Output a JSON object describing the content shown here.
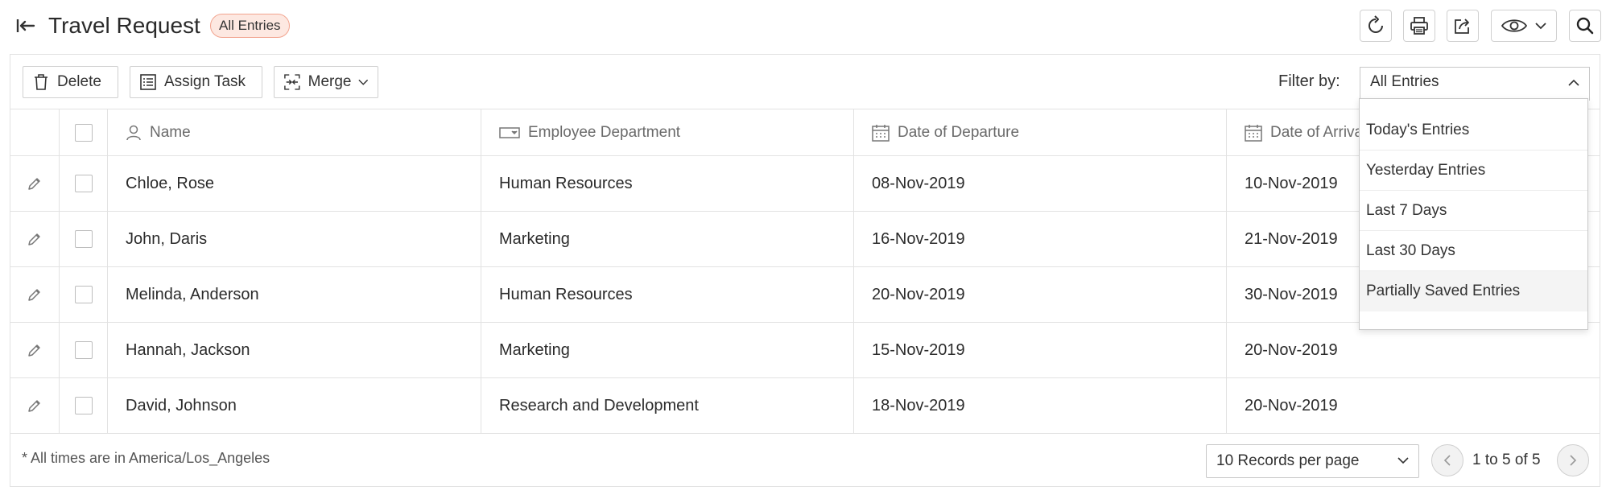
{
  "header": {
    "title": "Travel Request",
    "badge": "All Entries",
    "buttons": [
      "refresh-icon",
      "print-icon",
      "share-icon",
      "eye-icon",
      "search-icon"
    ]
  },
  "toolbar": {
    "delete_label": "Delete",
    "assign_label": "Assign Task",
    "merge_label": "Merge",
    "filter_label": "Filter by:",
    "filter_value": "All Entries"
  },
  "filter_options": [
    "Today's Entries",
    "Yesterday Entries",
    "Last 7 Days",
    "Last 30 Days",
    "Partially Saved Entries"
  ],
  "table": {
    "columns": {
      "name": "Name",
      "department": "Employee Department",
      "departure": "Date of Departure",
      "arrival": "Date of Arrival"
    },
    "rows": [
      {
        "name": "Chloe, Rose",
        "department": "Human Resources",
        "departure": "08-Nov-2019",
        "arrival": "10-Nov-2019"
      },
      {
        "name": "John, Daris",
        "department": "Marketing",
        "departure": "16-Nov-2019",
        "arrival": "21-Nov-2019"
      },
      {
        "name": "Melinda, Anderson",
        "department": "Human Resources",
        "departure": "20-Nov-2019",
        "arrival": "30-Nov-2019"
      },
      {
        "name": "Hannah, Jackson",
        "department": "Marketing",
        "departure": "15-Nov-2019",
        "arrival": "20-Nov-2019"
      },
      {
        "name": "David, Johnson",
        "department": "Research and Development",
        "departure": "18-Nov-2019",
        "arrival": "20-Nov-2019"
      }
    ]
  },
  "footer": {
    "timezone_note": "* All times are in America/Los_Angeles",
    "per_page": "10 Records per page",
    "page_info": "1 to 5 of 5"
  },
  "colors": {
    "badge_bg": "#fde8e1",
    "badge_border": "#f2a48f",
    "border": "#e2e2e2"
  }
}
